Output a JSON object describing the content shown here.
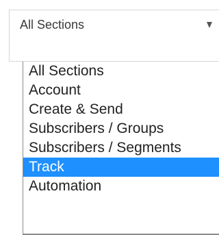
{
  "select": {
    "value": "All Sections",
    "arrow_icon": "triangle-down-icon"
  },
  "dropdown": {
    "options": [
      {
        "label": "All Sections"
      },
      {
        "label": "Account"
      },
      {
        "label": "Create & Send"
      },
      {
        "label": "Subscribers / Groups"
      },
      {
        "label": "Subscribers / Segments"
      },
      {
        "label": "Track",
        "highlighted": true
      },
      {
        "label": "Automation"
      }
    ],
    "highlight_color": "#1e90ff"
  }
}
